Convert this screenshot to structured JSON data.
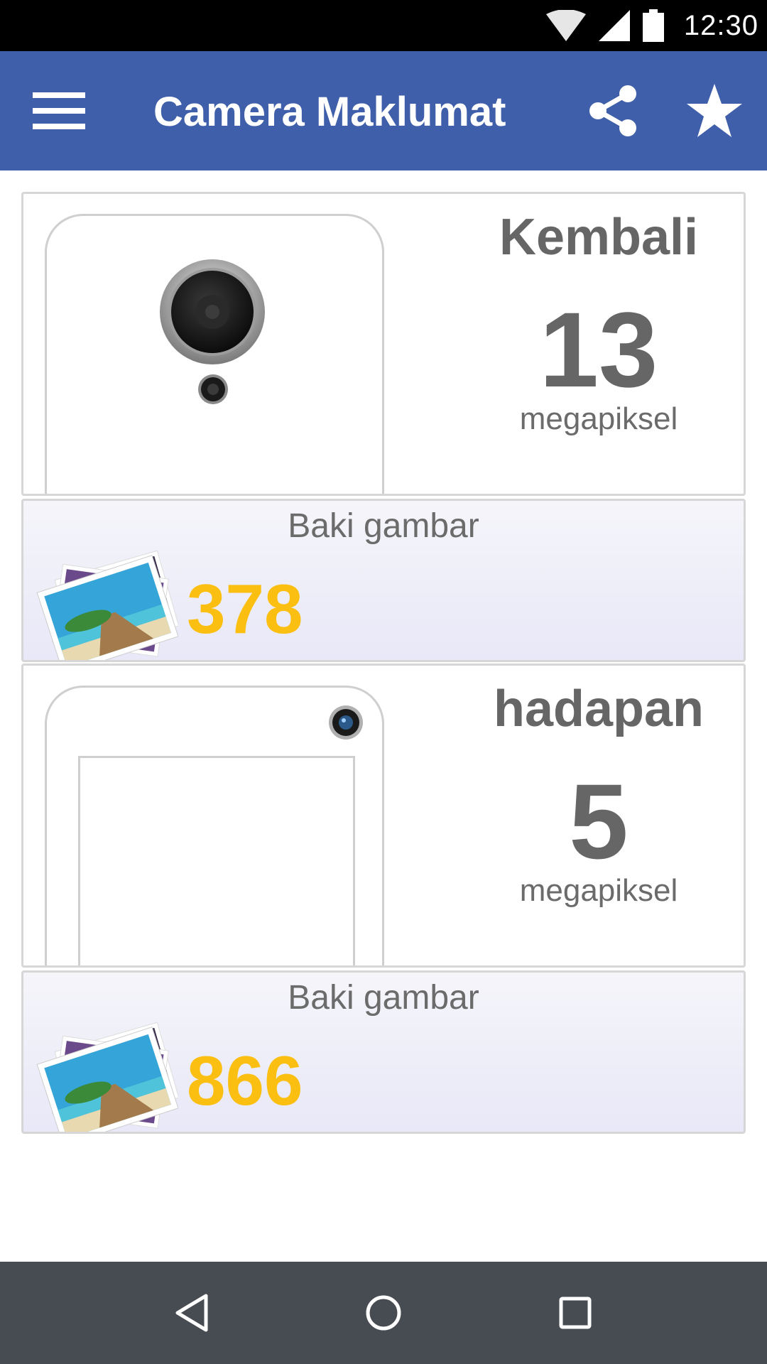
{
  "status_bar": {
    "time": "12:30",
    "icons": [
      "wifi-icon",
      "cell-signal-icon",
      "battery-icon"
    ]
  },
  "app_bar": {
    "title": "Camera Maklumat",
    "icons": [
      "menu-icon",
      "share-icon",
      "star-icon"
    ],
    "color": "#3f5faa"
  },
  "cameras": [
    {
      "label": "Kembali",
      "megapixels": "13",
      "unit": "megapiksel",
      "gallery_label": "Baki gambar",
      "gallery_count": "378"
    },
    {
      "label": "hadapan",
      "megapixels": "5",
      "unit": "megapiksel",
      "gallery_label": "Baki gambar",
      "gallery_count": "866"
    }
  ],
  "colors": {
    "accent_count": "#fbbf12",
    "text_gray": "#666666",
    "nav_bar": "#474c52"
  },
  "nav_bar": {
    "icons": [
      "back-icon",
      "home-icon",
      "recents-icon"
    ]
  }
}
